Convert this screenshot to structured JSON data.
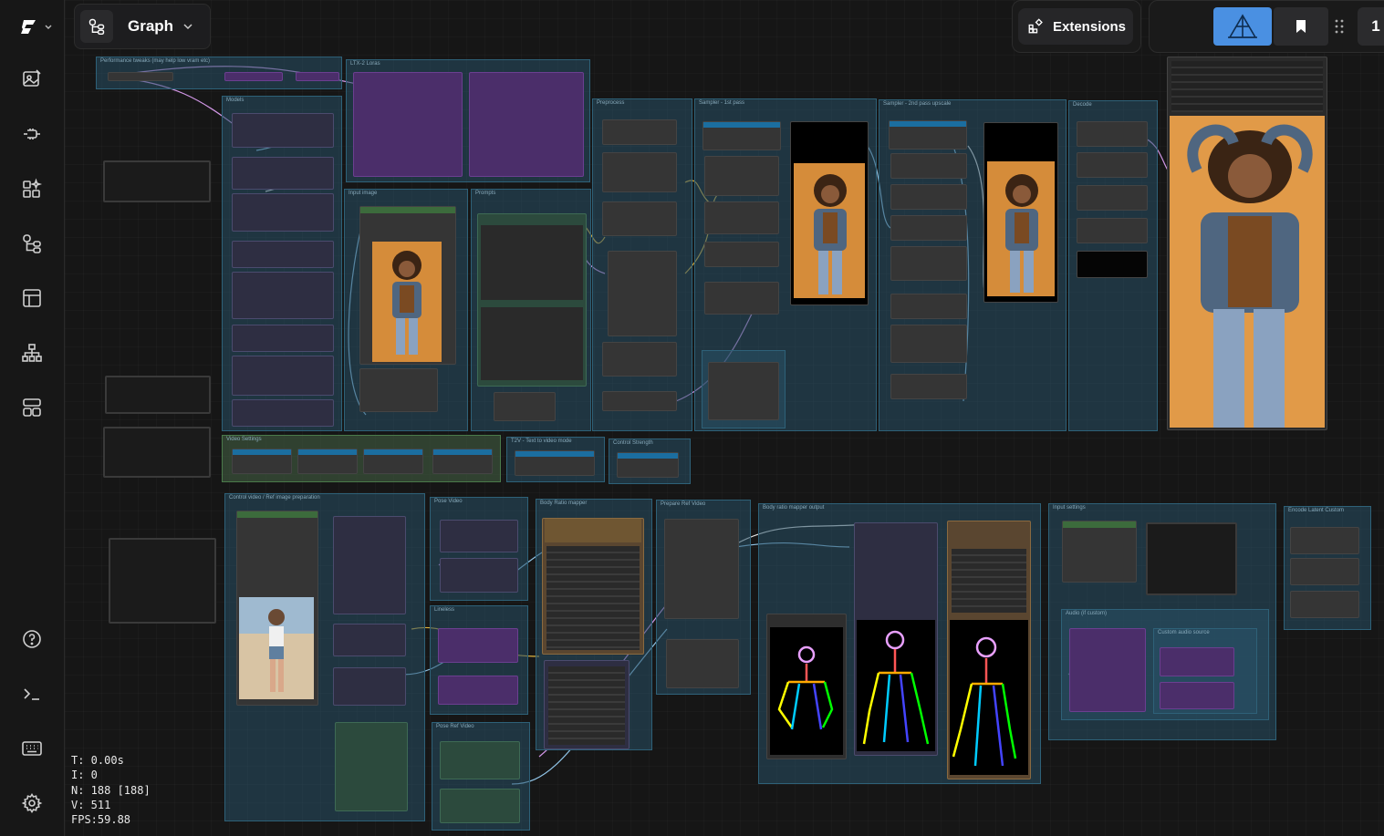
{
  "header": {
    "workflow_menu_label": "Graph",
    "extensions_label": "Extensions",
    "counter_label": "1"
  },
  "sidebar": {
    "items": [
      {
        "name": "images-icon"
      },
      {
        "name": "models-icon"
      },
      {
        "name": "nodes-icon"
      },
      {
        "name": "workflows-icon"
      },
      {
        "name": "templates-icon"
      },
      {
        "name": "node-map-icon"
      },
      {
        "name": "layout-icon"
      }
    ],
    "bottom": [
      {
        "name": "help-icon"
      },
      {
        "name": "terminal-icon"
      },
      {
        "name": "keyboard-icon"
      },
      {
        "name": "settings-icon"
      }
    ]
  },
  "stats": {
    "t": "T: 0.00s",
    "i": "I: 0",
    "n": "N: 188 [188]",
    "v": "V: 511",
    "fps": "FPS:59.88"
  },
  "groups": {
    "performance": "Performance tweaks (may help low vram etc)",
    "loras": "LTX-2 Loras",
    "models": "Models",
    "input_image": "Input image",
    "prompts": "Prompts",
    "preprocess": "Preprocess",
    "sampler1": "Sampler - 1st pass",
    "sampler2": "Sampler - 2nd pass upscale",
    "decode": "Decode",
    "video_settings": "Video Settings",
    "t2v": "T2V - Text to video mode",
    "control_strength": "Control Strength",
    "control_video": "Control video / Ref image preparation",
    "pose_video": "Pose Video",
    "body_ratio": "Body Ratio mapper",
    "prepare_ref": "Prepare Ref Video",
    "body_ratio_output": "Body ratio mapper output",
    "input_settings": "Input settings",
    "encode_latent": "Encode Latent Custom",
    "lineless": "Lineless",
    "pose_ref": "Pose Ref Video",
    "audio": "Audio (if custom)",
    "custom_audio": "Custom audio source"
  },
  "colors": {
    "accent": "#3b82f6",
    "group_bg": "#285066",
    "purple_node": "#4b2e6a",
    "link_colors": [
      "#e8a6ff",
      "#f5c542",
      "#9fd8ff",
      "#ffffff",
      "#8cf"
    ]
  }
}
